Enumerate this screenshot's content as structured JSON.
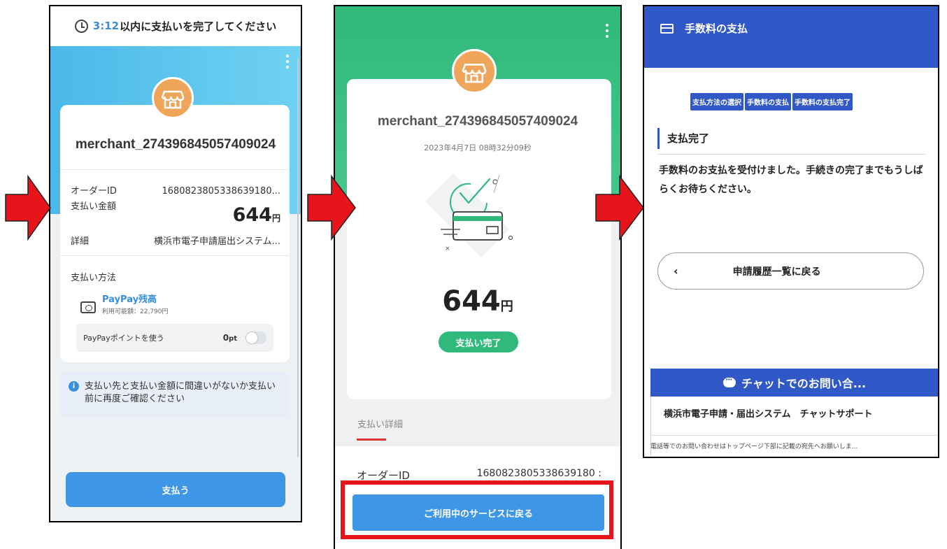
{
  "panel1": {
    "timer_time": "3:12",
    "timer_text": "以内に支払いを完了してください",
    "merchant": "merchant_274396845057409024",
    "order_id_label": "オーダーID",
    "order_id_value": "1680823805338639180...",
    "amount_label": "支払い金額",
    "amount_value": "644",
    "currency": "円",
    "details_label": "詳細",
    "details_value": "横浜市電子申請届出システム...",
    "payment_method_title": "支払い方法",
    "paypay_name": "PayPay残高",
    "paypay_available": "利用可能額：22,790円",
    "points_label": "PayPayポイントを使う",
    "points_value": "0",
    "points_unit": "pt",
    "notice": "支払い先と支払い金額に間違いがないか支払い前に再度ご確認ください",
    "pay_button": "支払う"
  },
  "panel2": {
    "merchant": "merchant_274396845057409024",
    "datetime": "2023年4月7日 08時32分09秒",
    "amount_value": "644",
    "currency": "円",
    "status_badge": "支払い完了",
    "detail_title": "支払い詳細",
    "order_id_label": "オーダーID",
    "order_id_value": "1680823805338639180 :",
    "return_button": "ご利用中のサービスに戻る"
  },
  "panel3": {
    "header_title": "手数料の支払",
    "steps": [
      "支払方法の選択",
      "手数料の支払",
      "手数料の支払完了"
    ],
    "section_title": "支払完了",
    "message": "手数料のお支払を受付けました。手続きの完了までもうしばらくお待ちください。",
    "back_link": "申請履歴一覧に戻る",
    "back_chevron": "‹",
    "chat_title": "チャットでのお問い合...",
    "chat_support": "横浜市電子申請・届出システム　チャットサポート",
    "chat_note": "電話等でのお問い合わせはトップページ下部に記載の宛先へお願いしま..."
  },
  "colors": {
    "arrow": "#e8141b",
    "paypay_blue": "#3d96e6",
    "success_green": "#2fb97a",
    "yokohama_blue": "#3058c6",
    "store_orange": "#efa65b"
  }
}
